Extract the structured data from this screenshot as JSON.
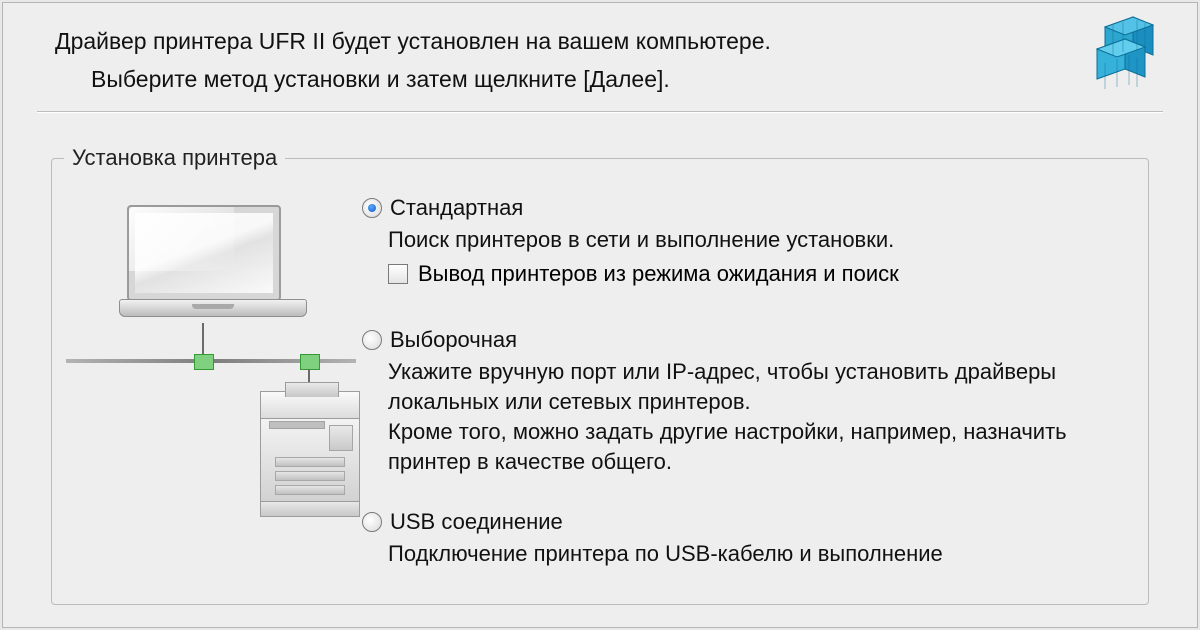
{
  "header": {
    "title": "Драйвер принтера UFR II будет установлен на вашем компьютере.",
    "subtitle": "Выберите метод установки и затем щелкните [Далее]."
  },
  "group": {
    "legend": "Установка принтера"
  },
  "options": {
    "standard": {
      "label": "Стандартная",
      "desc": "Поиск принтеров в сети и выполнение установки.",
      "wake_label": "Вывод принтеров из режима ожидания и поиск"
    },
    "custom": {
      "label": "Выборочная",
      "desc": "Укажите вручную порт или IP-адрес, чтобы установить драйверы локальных или сетевых принтеров.\nКроме того, можно задать другие настройки, например, назначить принтер в качестве общего."
    },
    "usb": {
      "label": "USB соединение",
      "desc": "Подключение принтера по USB-кабелю и выполнение"
    }
  }
}
